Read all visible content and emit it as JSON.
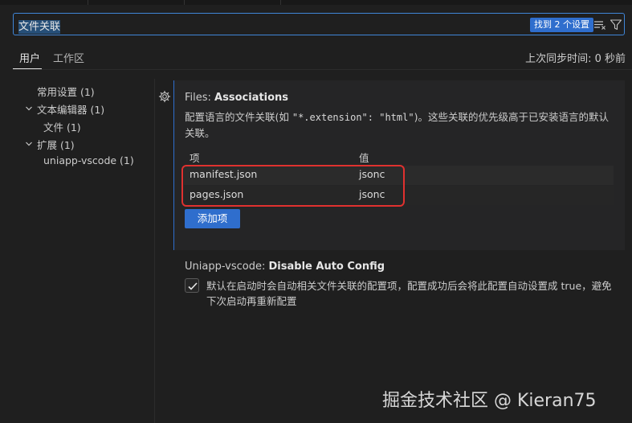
{
  "search": {
    "value": "文件关联",
    "result_badge": "找到 2 个设置"
  },
  "tabs": [
    {
      "label": "用户",
      "active": true
    },
    {
      "label": "工作区",
      "active": false
    }
  ],
  "last_sync": "上次同步时间: 0 秒前",
  "toc": [
    {
      "label": "常用设置 (1)",
      "level": 1,
      "chevron": false
    },
    {
      "label": "文本编辑器 (1)",
      "level": 1,
      "chevron": true
    },
    {
      "label": "文件 (1)",
      "level": 2,
      "chevron": false
    },
    {
      "label": "扩展 (1)",
      "level": 1,
      "chevron": true
    },
    {
      "label": "uniapp-vscode (1)",
      "level": 2,
      "chevron": false
    }
  ],
  "setting_associations": {
    "category": "Files: ",
    "name": "Associations",
    "desc_prefix": "配置语言的文件关联(如 ",
    "desc_key": "\"*.extension\": \"html\"",
    "desc_suffix": ")。这些关联的优先级高于已安装语言的默认关联。",
    "table_headers": [
      "项",
      "值"
    ],
    "rows": [
      {
        "item": "manifest.json",
        "value": "jsonc"
      },
      {
        "item": "pages.json",
        "value": "jsonc"
      }
    ],
    "add_button": "添加项"
  },
  "setting_auto_config": {
    "category": "Uniapp-vscode: ",
    "name": "Disable Auto Config",
    "checked": true,
    "desc": "默认在启动时会自动相关文件关联的配置项，配置成功后会将此配置自动设置成 true，避免下次启动再重新配置"
  },
  "watermark": "掘金技术社区 @ Kieran75",
  "colors": {
    "accent": "#2f6ecd",
    "highlight": "#e0312f",
    "background": "#1f1f1f"
  }
}
